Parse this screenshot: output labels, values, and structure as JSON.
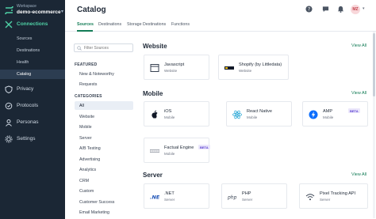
{
  "workspace": {
    "label": "Workspace",
    "name": "demo-ecommerce"
  },
  "sidebar": {
    "connections": "Connections",
    "sub": [
      "Sources",
      "Destinations",
      "Health",
      "Catalog"
    ],
    "items": [
      "Privacy",
      "Protocols",
      "Personas",
      "Settings"
    ]
  },
  "header": {
    "title": "Catalog",
    "tabs": [
      "Sources",
      "Destinations",
      "Storage Destinations",
      "Functions"
    ],
    "avatar": "MZ"
  },
  "filter": {
    "placeholder": "Filter Sources",
    "featured_label": "FEATURED",
    "featured": [
      "New & Noteworthy",
      "Requests"
    ],
    "categories_label": "CATEGORIES",
    "categories": [
      "All",
      "Website",
      "Mobile",
      "Server",
      "A/B Testing",
      "Advertising",
      "Analytics",
      "CRM",
      "Custom",
      "Customer Success",
      "Email Marketing"
    ]
  },
  "catalog": {
    "view_all": "View All",
    "website": {
      "title": "Website",
      "cards": [
        {
          "name": "Javascript",
          "category": "Website"
        },
        {
          "name": "Shopify (by Littledata)",
          "category": "Website"
        }
      ]
    },
    "mobile": {
      "title": "Mobile",
      "cards": [
        {
          "name": "iOS",
          "category": "Mobile"
        },
        {
          "name": "React Native",
          "category": "Mobile"
        },
        {
          "name": "AMP",
          "category": "Mobile",
          "badge": "BETA"
        },
        {
          "name": "Factual Engine",
          "category": "Mobile",
          "badge": "BETA"
        }
      ]
    },
    "server": {
      "title": "Server",
      "cards": [
        {
          "name": ".NET",
          "category": "Server"
        },
        {
          "name": "PHP",
          "category": "Server"
        },
        {
          "name": "Pixel Tracking API",
          "category": "Server"
        }
      ]
    }
  },
  "colors": {
    "sidebar_bg": "#1b2735",
    "accent": "#137c56",
    "active_nav": "#4fd1a6",
    "beta": "#5b3fd1"
  }
}
